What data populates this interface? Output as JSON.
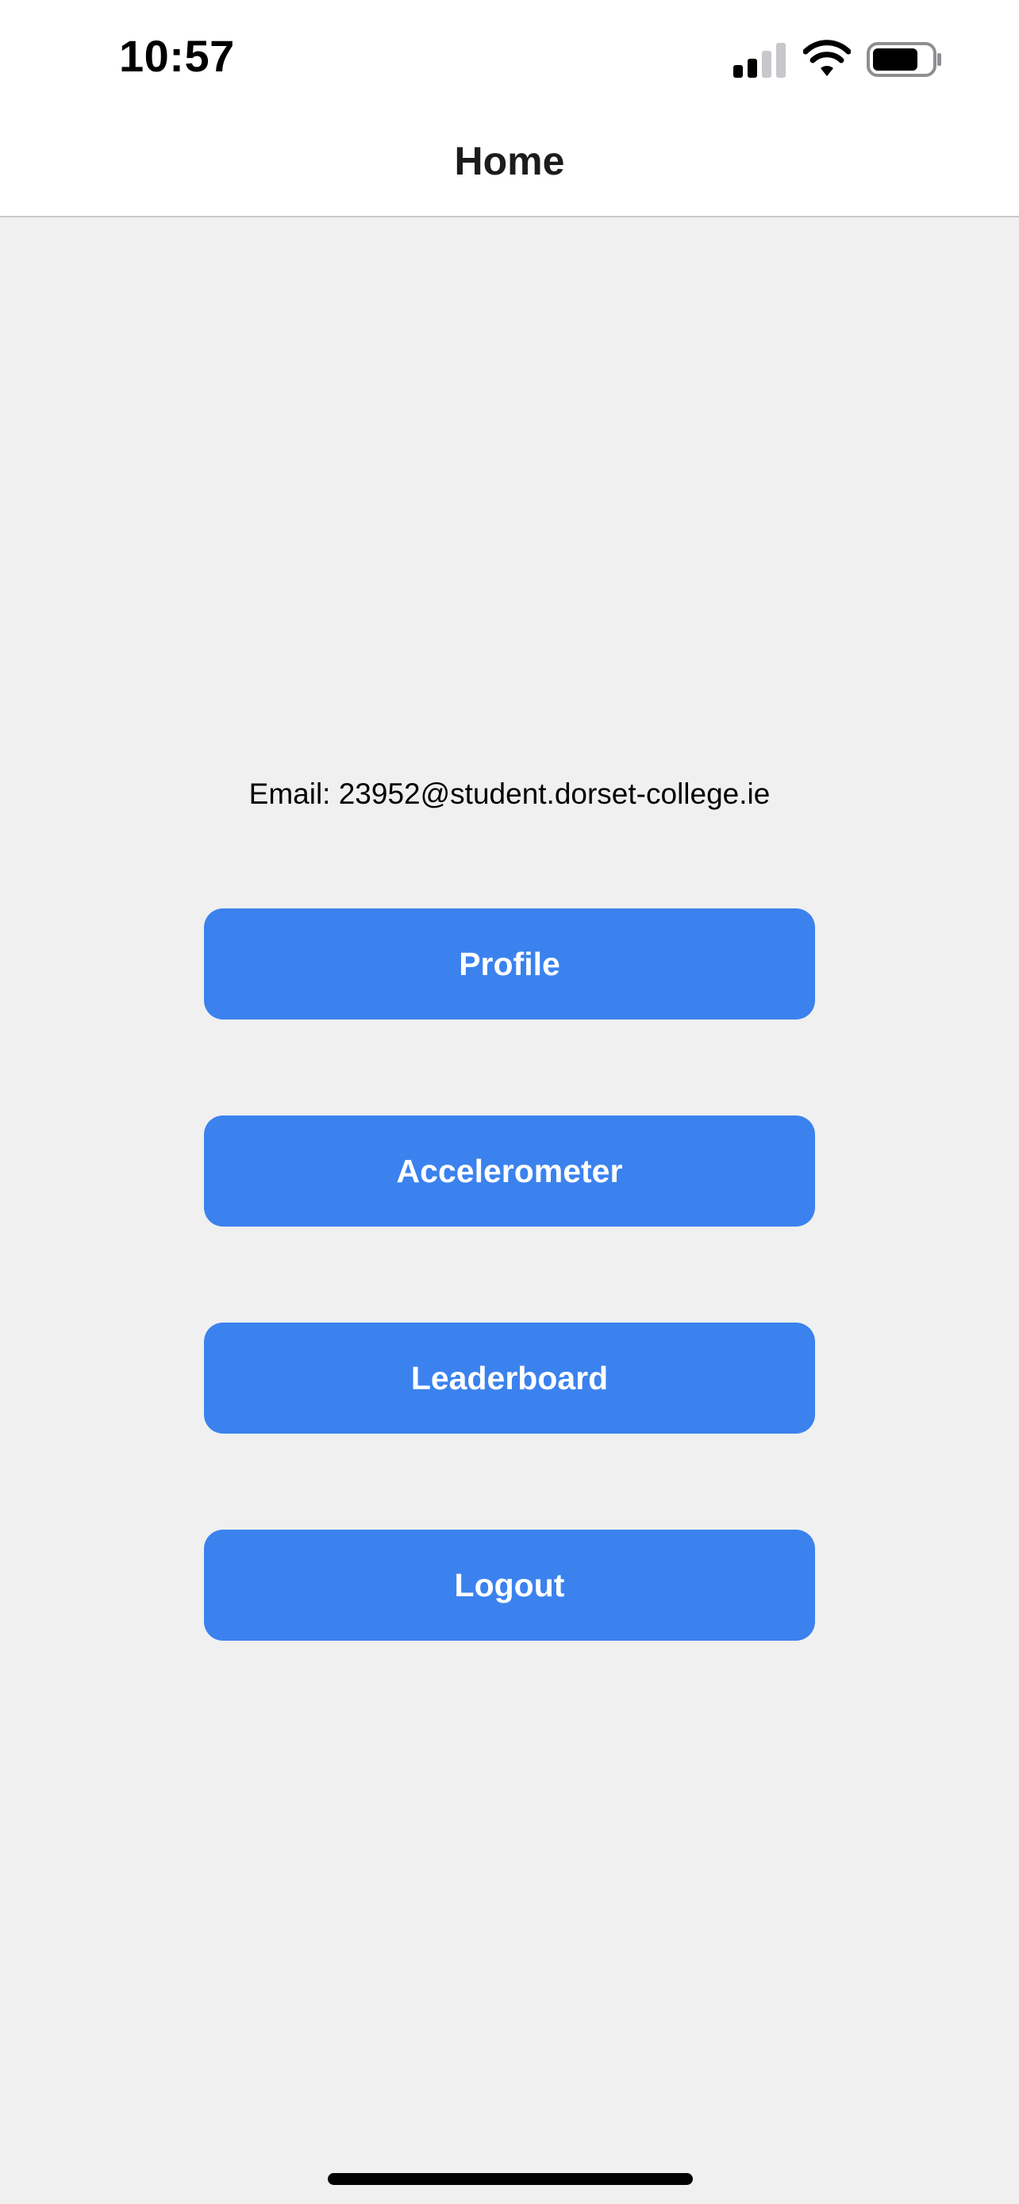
{
  "status_bar": {
    "time": "10:57",
    "icons": [
      "cellular-signal-icon",
      "wifi-icon",
      "battery-icon"
    ]
  },
  "nav": {
    "title": "Home"
  },
  "main": {
    "email_text": "Email: 23952@student.dorset-college.ie",
    "buttons": [
      {
        "label": "Profile"
      },
      {
        "label": "Accelerometer"
      },
      {
        "label": "Leaderboard"
      },
      {
        "label": "Logout"
      }
    ]
  },
  "colors": {
    "accent": "#3b82ee",
    "background": "#f0f0f0",
    "header_background": "#ffffff",
    "button_text": "#ffffff"
  }
}
